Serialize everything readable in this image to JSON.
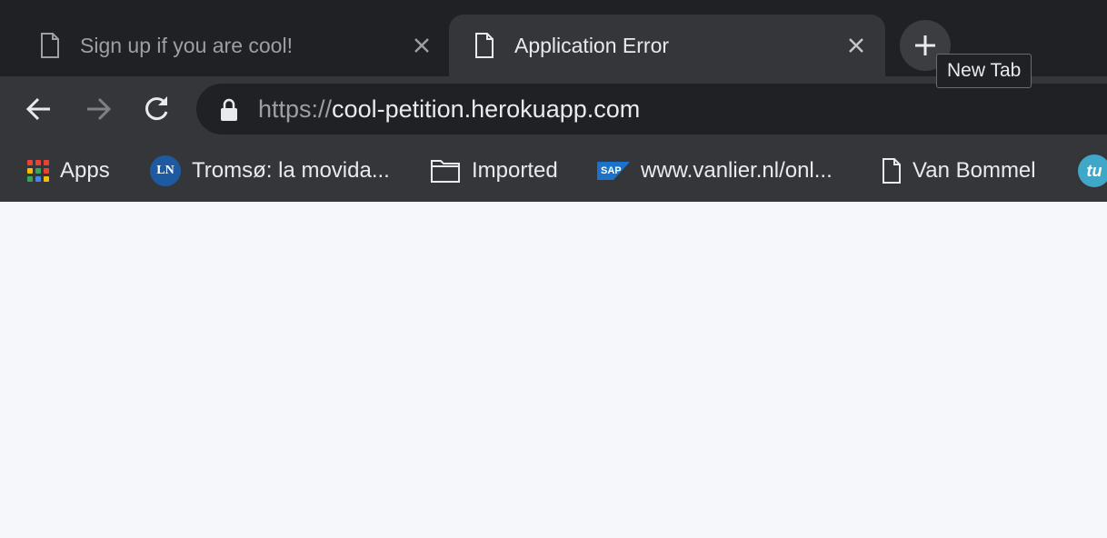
{
  "tabs": [
    {
      "title": "Sign up if you are cool!",
      "active": false
    },
    {
      "title": "Application Error",
      "active": true
    }
  ],
  "new_tab_tooltip": "New Tab",
  "address_bar": {
    "scheme": "https://",
    "host_path": "cool-petition.herokuapp.com"
  },
  "bookmarks": [
    {
      "label": "Apps",
      "icon": "apps-grid-icon"
    },
    {
      "label": "Tromsø: la movida...",
      "icon": "ln-favicon"
    },
    {
      "label": "Imported",
      "icon": "folder-icon"
    },
    {
      "label": "www.vanlier.nl/onl...",
      "icon": "sap-favicon"
    },
    {
      "label": "Van Bommel",
      "icon": "page-icon"
    },
    {
      "label": "",
      "icon": "tu-favicon"
    }
  ],
  "colors": {
    "tabstrip": "#202124",
    "active_tab": "#35363a",
    "page_background": "#f6f7fa"
  }
}
